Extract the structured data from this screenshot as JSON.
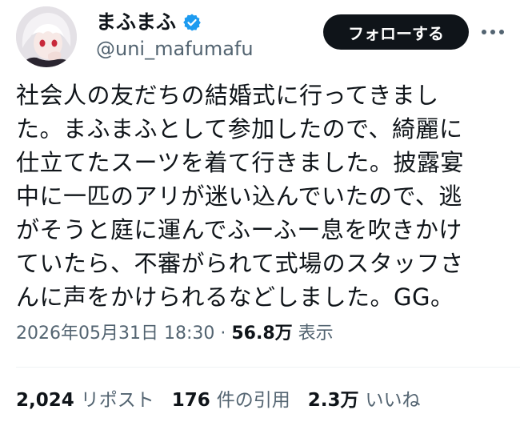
{
  "user": {
    "display_name": "まふまふ",
    "handle": "@uni_mafumafu",
    "verified": true
  },
  "actions": {
    "follow_label": "フォローする",
    "more_icon": "more-options-icon"
  },
  "tweet": {
    "lines": [
      "社会人の友だちの結婚式に行ってきまし",
      "た。まふまふとして参加したので、綺麗に",
      "仕立てたスーツを着て行きました。披露宴",
      "中に一匹のアリが迷い込んでいたので、逃",
      "がそうと庭に運んでふーふー息を吹きかけ",
      "ていたら、不審がられて式場のスタッフさ",
      "んに声をかけられるなどしました。GG。"
    ]
  },
  "meta": {
    "timestamp": "2026年05月31日 18:30",
    "separator": "·",
    "views_count": "56.8万",
    "views_label": "表示"
  },
  "stats": {
    "reposts_count": "2,024",
    "reposts_label": "リポスト",
    "quotes_count": "176",
    "quotes_label": "件の引用",
    "likes_count": "2.3万",
    "likes_label": "いいね"
  },
  "colors": {
    "text": "#0f1419",
    "muted": "#536471",
    "verified": "#1d9bf0",
    "button_bg": "#0f1419",
    "button_text": "#ffffff"
  }
}
